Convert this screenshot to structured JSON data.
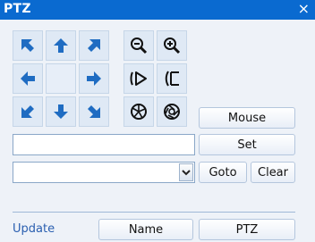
{
  "window": {
    "title": "PTZ",
    "close_icon": "×"
  },
  "pad": {
    "direction_icons": [
      "arrow-up-left",
      "arrow-up",
      "arrow-up-right",
      "arrow-left",
      "arrow-right",
      "arrow-down-left",
      "arrow-down",
      "arrow-down-right"
    ],
    "zoom_icons": [
      "zoom-out",
      "zoom-in"
    ],
    "focus_icons": [
      "focus-far",
      "focus-near"
    ],
    "iris_icons": [
      "iris-open",
      "iris-close"
    ]
  },
  "buttons": {
    "mouse": "Mouse",
    "set": "Set",
    "goto": "Goto",
    "clear": "Clear",
    "name": "Name",
    "ptz": "PTZ"
  },
  "preset_name": {
    "value": ""
  },
  "preset_select": {
    "value": ""
  },
  "update_link": "Update",
  "colors": {
    "title_bar": "#0a6ad0",
    "arrow": "#1f6cc2",
    "background": "#eef2f8"
  }
}
